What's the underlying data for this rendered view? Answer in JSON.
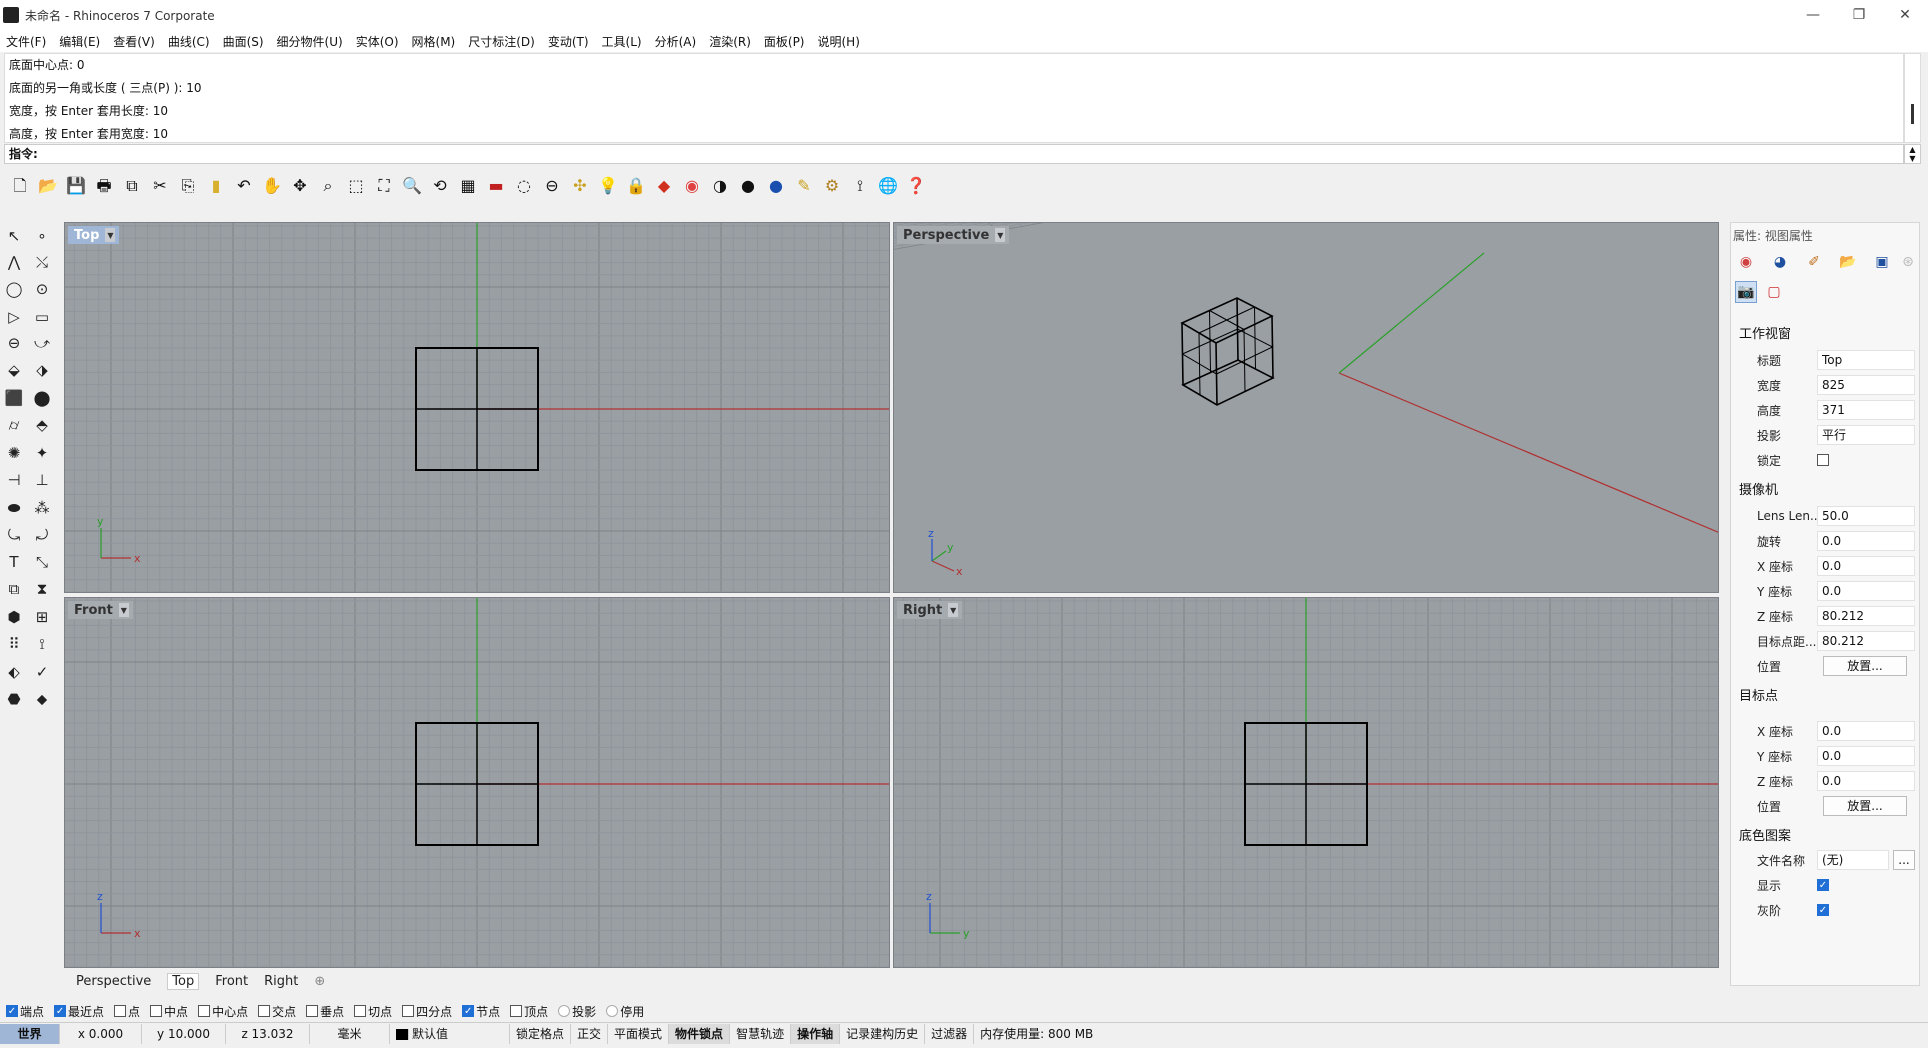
{
  "window": {
    "title": "未命名 - Rhinoceros 7 Corporate",
    "controls": {
      "minimize": "—",
      "restore": "❐",
      "close": "✕"
    }
  },
  "menu": [
    "文件(F)",
    "编辑(E)",
    "查看(V)",
    "曲线(C)",
    "曲面(S)",
    "细分物件(U)",
    "实体(O)",
    "网格(M)",
    "尺寸标注(D)",
    "变动(T)",
    "工具(L)",
    "分析(A)",
    "渲染(R)",
    "面板(P)",
    "说明(H)"
  ],
  "history": [
    "底面中心点: 0",
    "底面的另一角或长度 ( 三点(P) ): 10",
    "宽度，按 Enter 套用长度: 10",
    "高度，按 Enter 套用宽度: 10"
  ],
  "command": {
    "label": "指令:"
  },
  "viewports": {
    "top": {
      "label": "Top"
    },
    "perspective": {
      "label": "Perspective"
    },
    "front": {
      "label": "Front"
    },
    "right": {
      "label": "Right"
    }
  },
  "axis_letters": {
    "x": "x",
    "y": "y",
    "z": "z"
  },
  "viewport_tabs": {
    "items": [
      "Perspective",
      "Top",
      "Front",
      "Right"
    ],
    "active": "Top",
    "add": "⊕"
  },
  "osnaps": [
    {
      "label": "端点",
      "checked": true
    },
    {
      "label": "最近点",
      "checked": true
    },
    {
      "label": "点",
      "checked": false
    },
    {
      "label": "中点",
      "checked": false
    },
    {
      "label": "中心点",
      "checked": false
    },
    {
      "label": "交点",
      "checked": false
    },
    {
      "label": "垂点",
      "checked": false
    },
    {
      "label": "切点",
      "checked": false
    },
    {
      "label": "四分点",
      "checked": false
    },
    {
      "label": "节点",
      "checked": true
    },
    {
      "label": "顶点",
      "checked": false
    },
    {
      "label": "投影",
      "checked": false
    },
    {
      "label": "停用",
      "checked": false
    }
  ],
  "status": {
    "cplane": "世界",
    "x": "x 0.000",
    "y": "y 10.000",
    "z": "z 13.032",
    "unit": "毫米",
    "layer": "默认值",
    "toggles": [
      "锁定格点",
      "正交",
      "平面模式",
      "物件锁点",
      "智慧轨迹",
      "操作轴",
      "记录建构历史",
      "过滤器"
    ],
    "bold_toggles": [
      "物件锁点",
      "操作轴"
    ],
    "memory": "内存使用量: 800 MB"
  },
  "panel": {
    "title": "属性: 视图属性",
    "sections": {
      "viewport": "工作视窗",
      "camera": "摄像机",
      "target": "目标点",
      "wallpaper": "底色图案"
    },
    "viewport_props": [
      {
        "label": "标题",
        "value": "Top"
      },
      {
        "label": "宽度",
        "value": "825"
      },
      {
        "label": "高度",
        "value": "371"
      },
      {
        "label": "投影",
        "value": "平行"
      },
      {
        "label": "锁定",
        "value": ""
      }
    ],
    "camera_props": [
      {
        "label": "Lens Len...",
        "value": "50.0"
      },
      {
        "label": "旋转",
        "value": "0.0"
      },
      {
        "label": "X 座标",
        "value": "0.0"
      },
      {
        "label": "Y 座标",
        "value": "0.0"
      },
      {
        "label": "Z 座标",
        "value": "80.212"
      },
      {
        "label": "目标点距...",
        "value": "80.212"
      }
    ],
    "camera_position": {
      "label": "位置",
      "button": "放置..."
    },
    "target_props": [
      {
        "label": "X 座标",
        "value": "0.0"
      },
      {
        "label": "Y 座标",
        "value": "0.0"
      },
      {
        "label": "Z 座标",
        "value": "0.0"
      }
    ],
    "target_position": {
      "label": "位置",
      "button": "放置..."
    },
    "wallpaper_props": {
      "filename_label": "文件名称",
      "filename_value": "(无)",
      "browse": "...",
      "show_label": "显示",
      "show_checked": true,
      "gray_label": "灰阶",
      "gray_checked": true
    }
  },
  "colors": {
    "grid_bg": "#9a9fa4",
    "grid_minor": "#8f959b",
    "grid_major": "#7d8389",
    "x_axis": "#b03030",
    "y_axis": "#2aa02a",
    "active_label": "#9fb6d6"
  }
}
